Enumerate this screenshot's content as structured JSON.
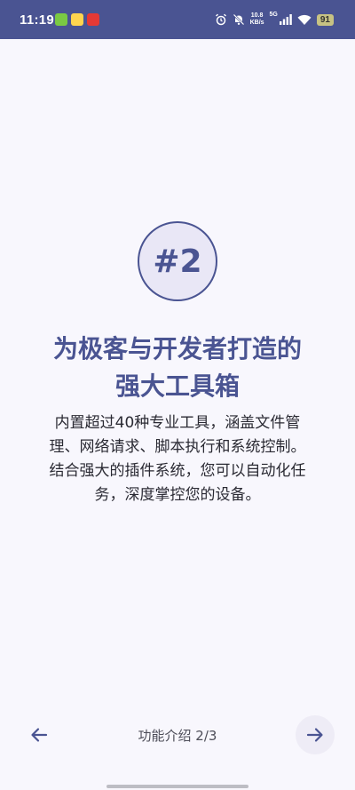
{
  "status_bar": {
    "time": "11:19",
    "net_speed_value": "10.8",
    "net_speed_unit": "KB/s",
    "signal_label": "5G",
    "battery": "91",
    "icons": [
      "alarm-icon",
      "mute-bell-icon",
      "signal-icon",
      "wifi-icon",
      "battery-icon"
    ],
    "background": "#4a5492"
  },
  "badge": {
    "label": "#2"
  },
  "title": {
    "line1": "为极客与开发者打造的",
    "line2": "强大工具箱"
  },
  "description": {
    "lines": [
      "内置超过40种专业工具，涵盖文件管",
      "理、网络请求、脚本执行和系统控制。",
      "结合强大的插件系统，您可以自动化任",
      "务，深度掌控您的设备。"
    ]
  },
  "navigation": {
    "page_label": "功能介绍 2/3",
    "back_icon": "arrow-left-icon",
    "next_icon": "arrow-right-icon"
  },
  "colors": {
    "accent": "#4a5492",
    "background": "#f8f7fd",
    "badge_fill": "#e9e7f6"
  }
}
